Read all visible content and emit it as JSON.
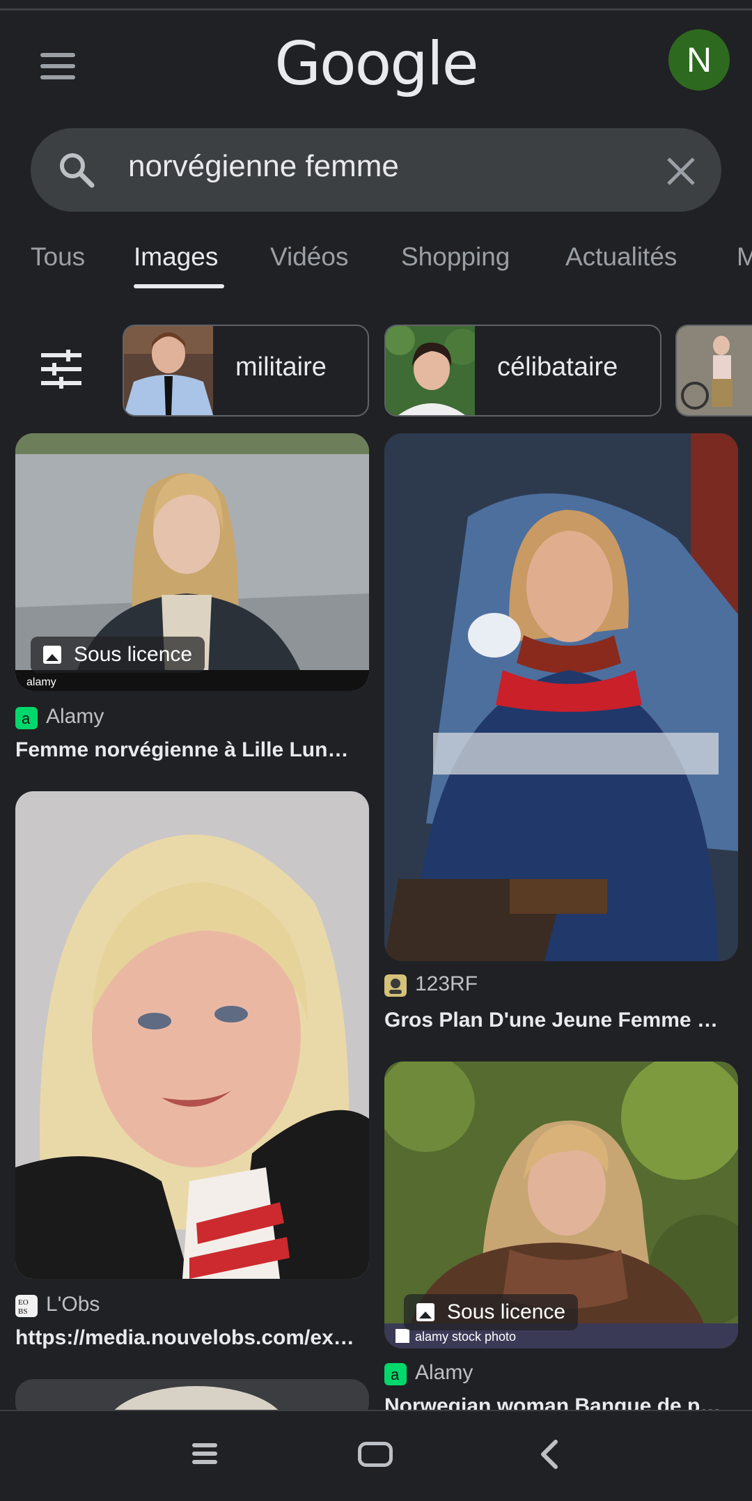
{
  "header": {
    "logo": "Google",
    "avatar_letter": "N"
  },
  "search": {
    "query": "norvégienne femme"
  },
  "tabs": [
    {
      "label": "Tous",
      "active": false
    },
    {
      "label": "Images",
      "active": true
    },
    {
      "label": "Vidéos",
      "active": false
    },
    {
      "label": "Shopping",
      "active": false
    },
    {
      "label": "Actualités",
      "active": false
    },
    {
      "label": "M",
      "active": false
    }
  ],
  "chips": [
    {
      "label": "militaire"
    },
    {
      "label": "célibataire"
    }
  ],
  "results": [
    {
      "source": "Alamy",
      "title": "Femme norvégienne à Lille Lung…",
      "badge": "Sous licence",
      "watermark": "alamy"
    },
    {
      "source": "123RF",
      "title": "Gros Plan D'une Jeune Femme J…"
    },
    {
      "source": "L'Obs",
      "title": "https://media.nouvelobs.com/ex…"
    },
    {
      "source": "Alamy",
      "title": "Norwegian woman Banque de ph…",
      "badge": "Sous licence",
      "watermark": "alamy stock photo"
    }
  ],
  "colors": {
    "background": "#202124",
    "avatar": "#2d6a1f",
    "search_bg": "#3c4043"
  }
}
